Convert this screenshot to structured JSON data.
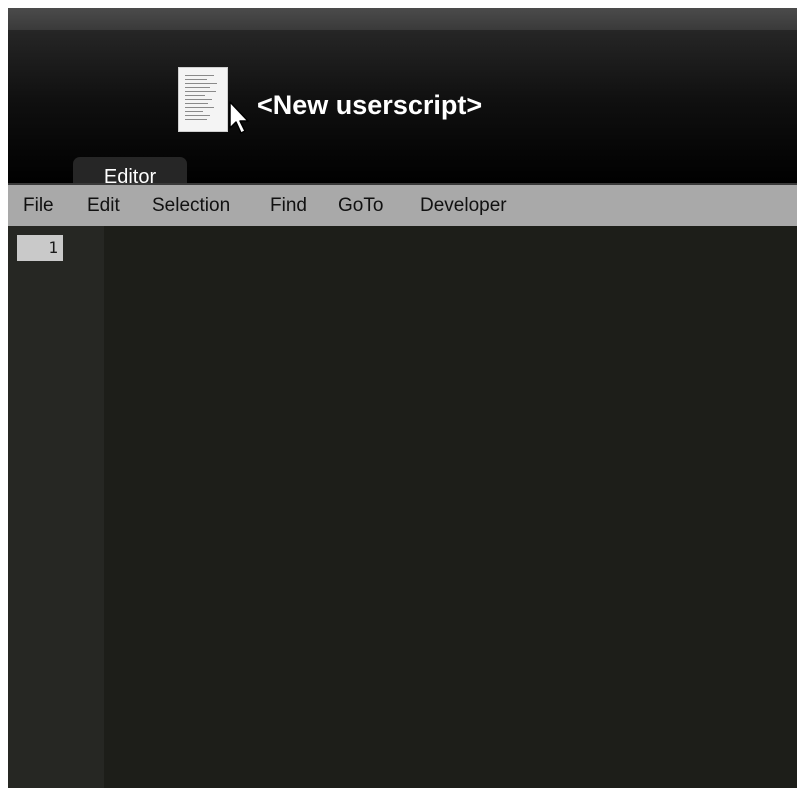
{
  "header": {
    "script_icon": "script-document-icon",
    "cursor_icon": "mouse-pointer-icon",
    "title": "<New userscript>"
  },
  "tabs": [
    {
      "label": "Editor",
      "active": true
    }
  ],
  "menu": {
    "items": [
      {
        "label": "File"
      },
      {
        "label": "Edit"
      },
      {
        "label": "Selection"
      },
      {
        "label": "Find"
      },
      {
        "label": "GoTo"
      },
      {
        "label": "Developer"
      }
    ]
  },
  "editor": {
    "line_numbers": [
      "1"
    ],
    "content": ""
  },
  "colors": {
    "header_background": "#000000",
    "tab_background": "#262626",
    "menubar_background": "#a9a9a9",
    "editor_background": "#1d1e19",
    "gutter_background": "#262723",
    "active_line_number_background": "#c9c9c9"
  }
}
